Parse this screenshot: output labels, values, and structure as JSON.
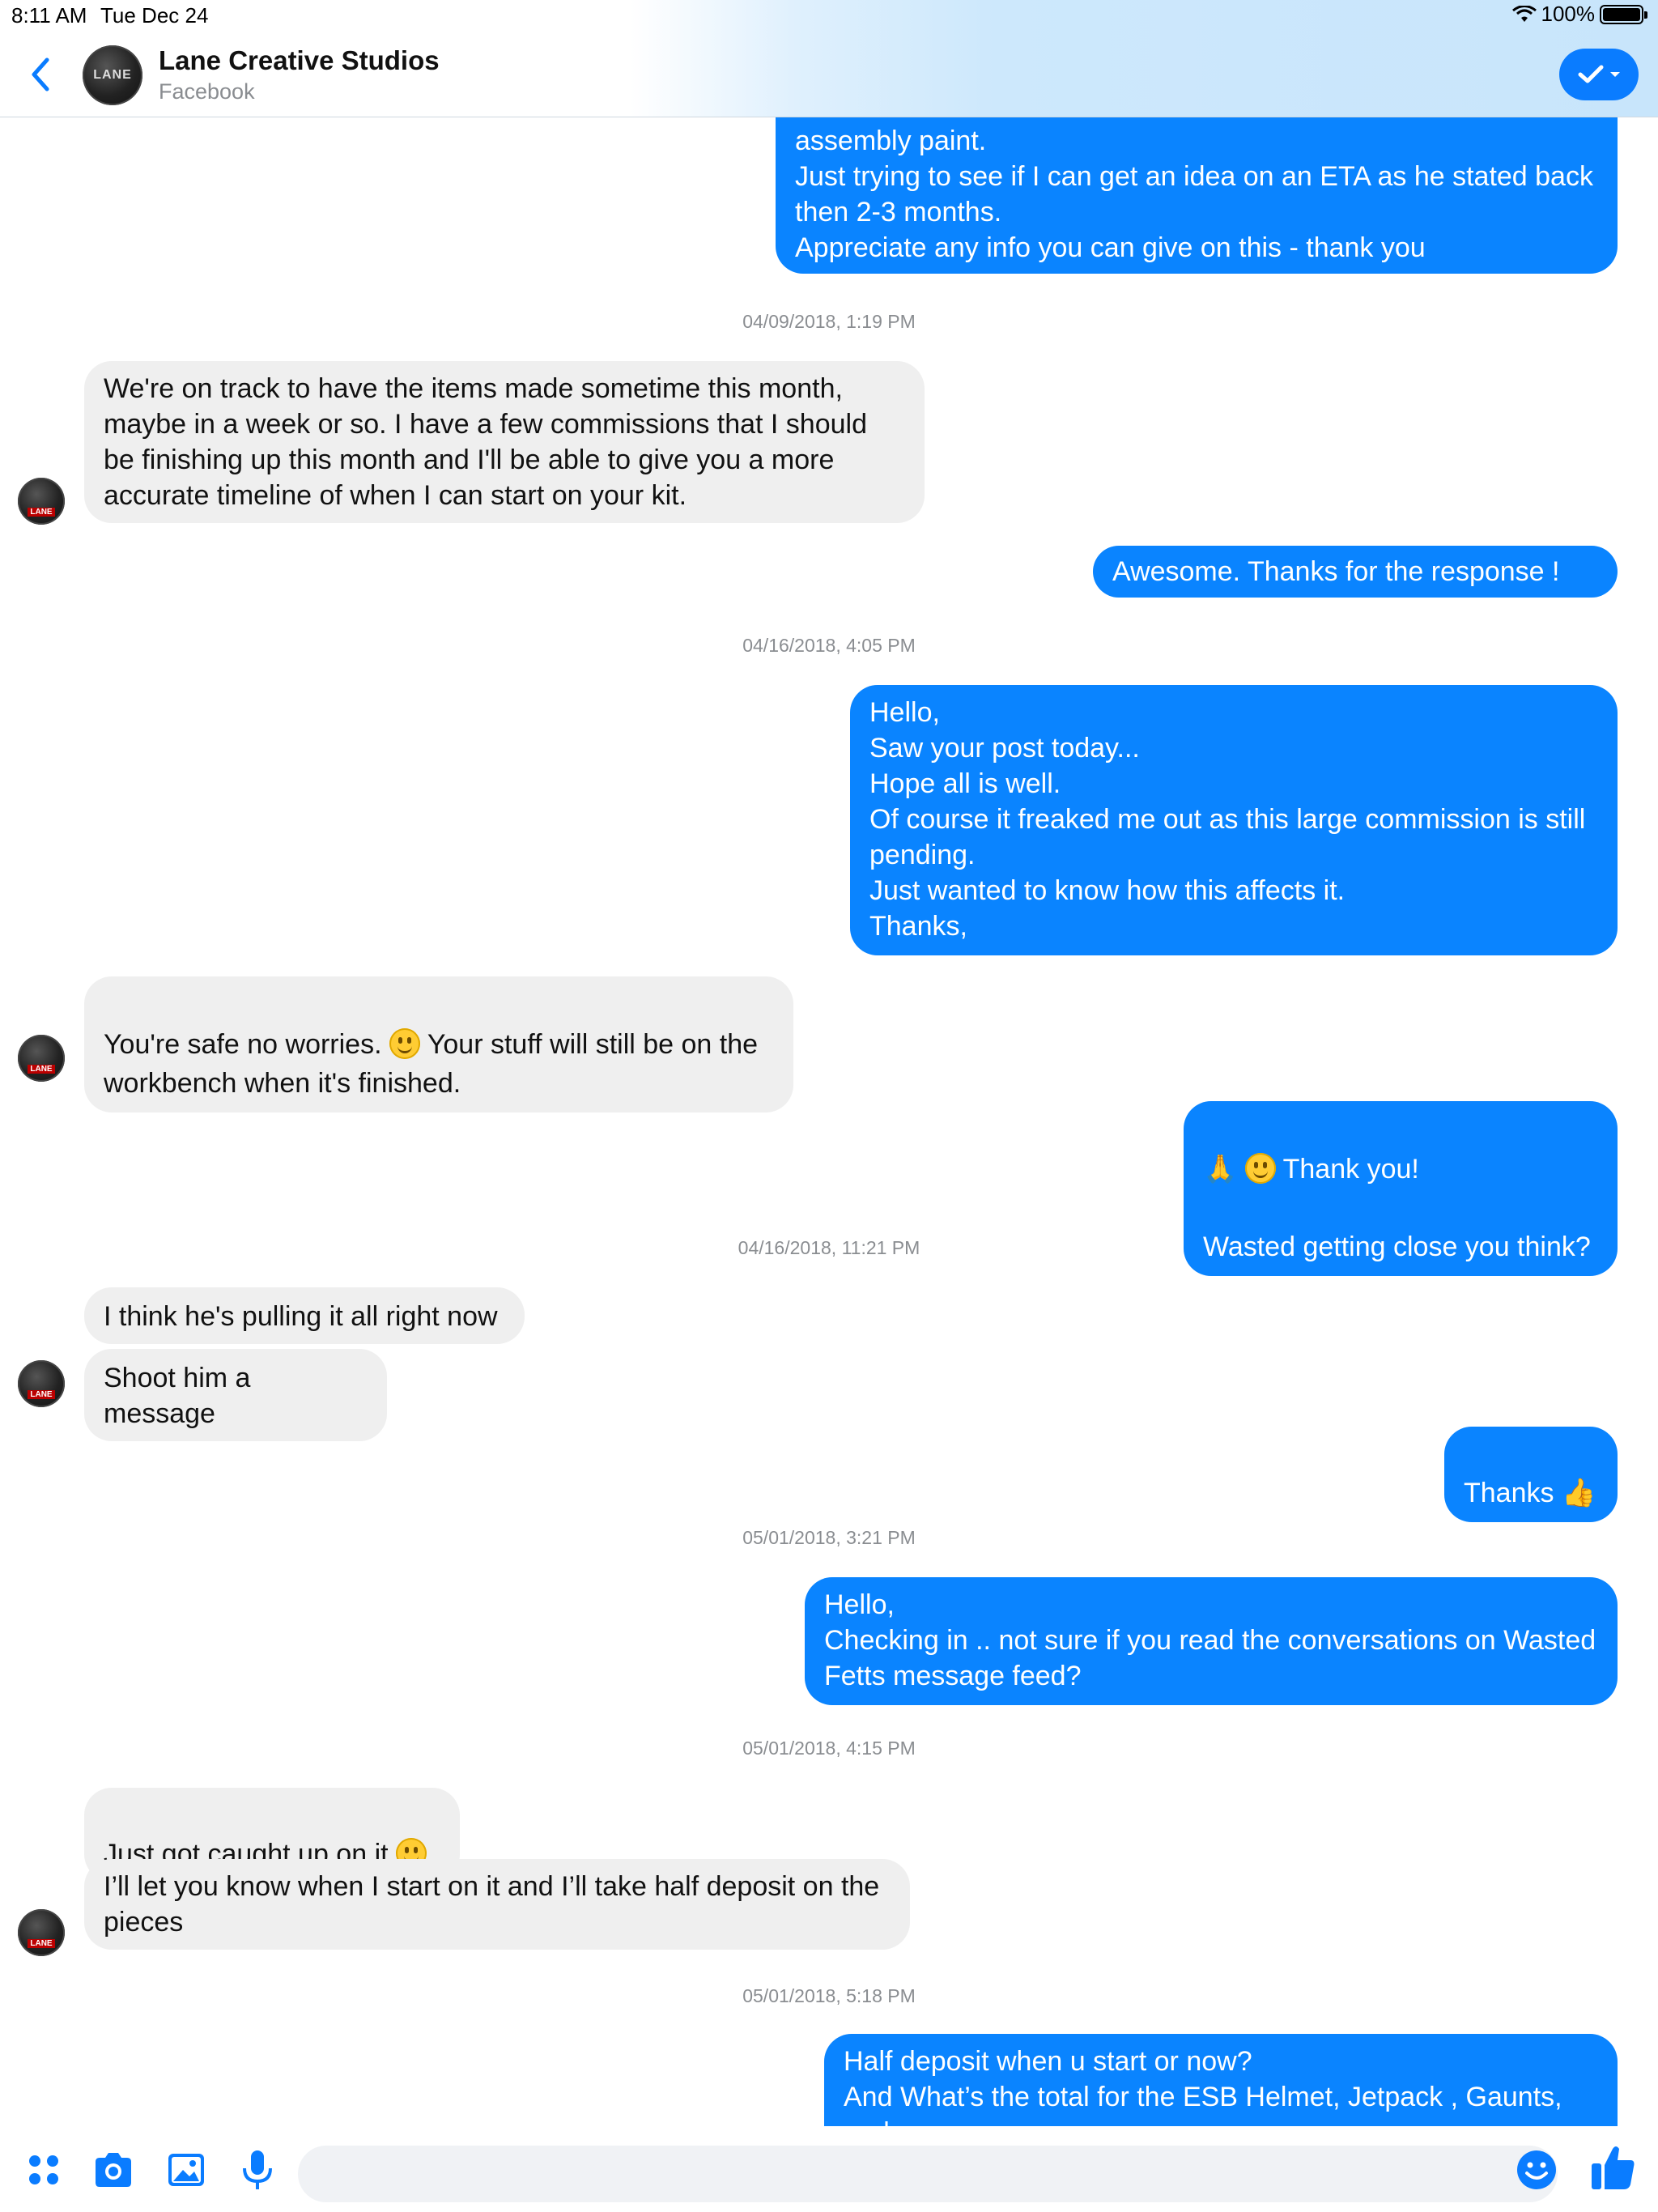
{
  "status": {
    "time": "8:11 AM",
    "date": "Tue Dec 24",
    "battery": "100%"
  },
  "header": {
    "name": "Lane Creative Studios",
    "subtitle": "Facebook",
    "avatar_text": "LANE"
  },
  "messages": {
    "m1": "assembly paint.\nJust trying to see if I can get an idea on an ETA as he stated back then 2-3 months.\nAppreciate any info you can give on this - thank you",
    "ts1": "04/09/2018, 1:19 PM",
    "m2": "We're on track to have the items made sometime this month, maybe in a week or so. I have a few commissions that I should be finishing up this month and I'll be able to give you a more accurate timeline of when I can start on your kit.",
    "m3": "Awesome. Thanks for the response !",
    "ts2": "04/16/2018, 4:05 PM",
    "m4": "Hello,\nSaw your post today...\nHope all is well.\nOf course it freaked me out as this large commission is still pending.\nJust wanted to know how this affects it.\nThanks,",
    "m5a": "You're safe no worries. ",
    "m5b": " Your stuff will still be on the workbench when it's finished.",
    "m6a": "🙏",
    "m6b": " Thank you!",
    "m6c": "Wasted getting close you think?",
    "ts3": "04/16/2018, 11:21 PM",
    "m7": "I think he's pulling it all right now",
    "m8": "Shoot him a message",
    "m9a": "Thanks ",
    "m9b": "👍",
    "ts4": "05/01/2018, 3:21 PM",
    "m10": "Hello,\nChecking in .. not sure if you read the conversations on Wasted Fetts message feed?",
    "ts5": "05/01/2018, 4:15 PM",
    "m11": "Just got caught up on it ",
    "m12": "I’ll let you know when I start on it and I’ll take half deposit on the pieces",
    "ts6": "05/01/2018, 5:18 PM",
    "m13": "Half deposit when u start or now?\nAnd What’s the total for the ESB Helmet, Jetpack , Gaunts, and"
  },
  "icons": {
    "back": "chevron-left-icon",
    "done": "checkmark-icon",
    "apps": "apps-grid-icon",
    "camera": "camera-icon",
    "gallery": "photo-icon",
    "mic": "microphone-icon",
    "emoji": "smiley-icon",
    "like": "thumbs-up-icon"
  },
  "colors": {
    "accent": "#0a84ff",
    "incoming_bubble": "#efefef"
  }
}
